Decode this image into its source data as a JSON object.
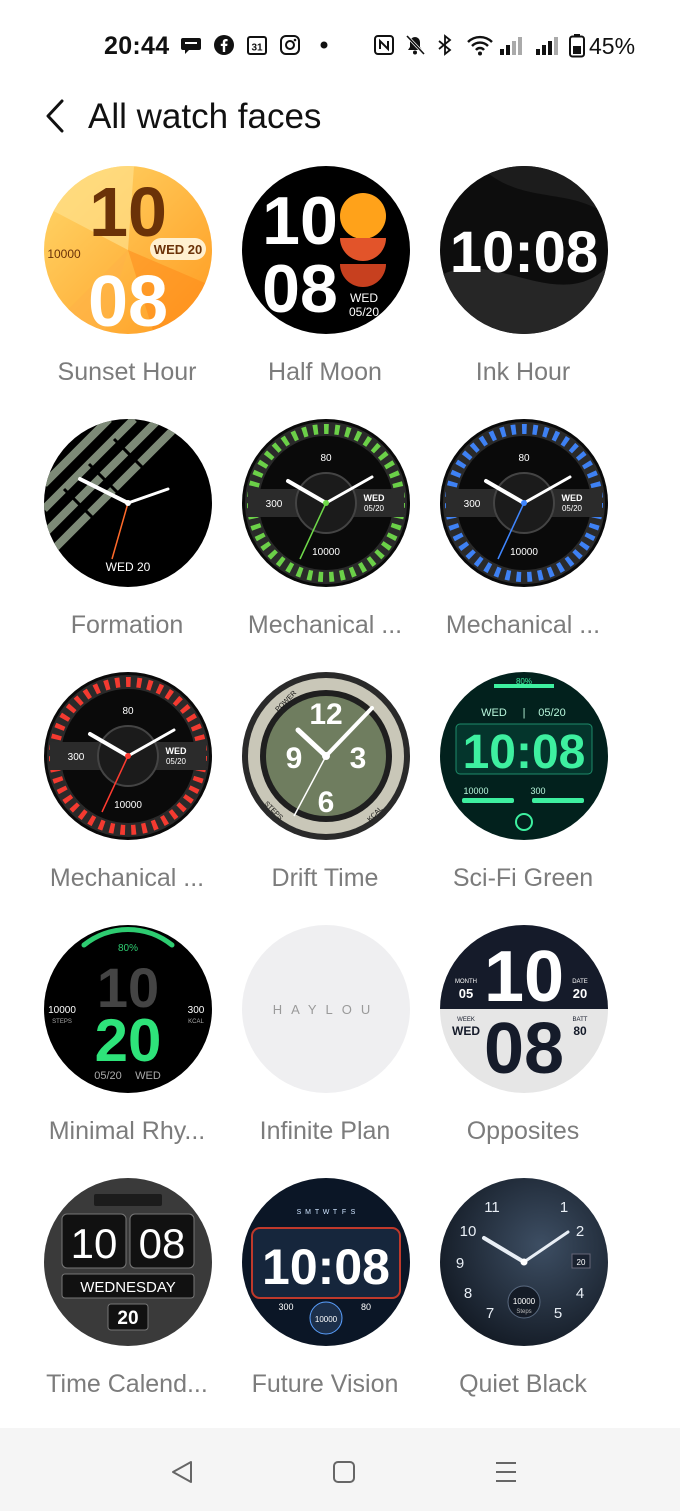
{
  "status_bar": {
    "time": "20:44",
    "battery_percent": "45%",
    "icons": [
      "messages-icon",
      "facebook-icon",
      "calendar-icon",
      "instagram-icon",
      "dot-icon",
      "nfc-icon",
      "mute-icon",
      "bluetooth-icon",
      "wifi-icon",
      "signal-icon",
      "signal-icon",
      "battery-icon"
    ]
  },
  "header": {
    "title": "All watch faces",
    "back_icon": "chevron-left-icon"
  },
  "faces": [
    {
      "label": "Sunset Hour",
      "hour": "10",
      "minute": "08",
      "date": "WED 20",
      "steps": "10000"
    },
    {
      "label": "Half Moon",
      "hour": "10",
      "minute": "08",
      "day": "WED",
      "date": "05/20"
    },
    {
      "label": "Ink Hour",
      "time": "10:08"
    },
    {
      "label": "Formation",
      "date": "WED 20"
    },
    {
      "label": "Mechanical ...",
      "hr": "80",
      "kcal": "300",
      "day": "WED",
      "date": "05/20",
      "steps": "10000",
      "accent": "#6fd94a"
    },
    {
      "label": "Mechanical ...",
      "hr": "80",
      "kcal": "300",
      "day": "WED",
      "date": "05/20",
      "steps": "10000",
      "accent": "#3f86ff"
    },
    {
      "label": "Mechanical ...",
      "hr": "80",
      "kcal": "300",
      "day": "WED",
      "date": "05/20",
      "steps": "10000",
      "accent": "#ff3b30"
    },
    {
      "label": "Drift Time",
      "n12": "12",
      "n9": "9",
      "n3": "3",
      "n6": "6",
      "power": "POWER",
      "steps": "STEPS",
      "kcal": "KCAL"
    },
    {
      "label": "Sci-Fi Green",
      "battery": "80%",
      "day": "WED",
      "date": "05/20",
      "time": "10:08",
      "steps": "10000",
      "kcal": "300"
    },
    {
      "label": "Minimal Rhy...",
      "battery": "80%",
      "hour": "10",
      "minute": "20",
      "steps": "10000",
      "steps_label": "STEPS",
      "kcal": "300",
      "kcal_label": "KCAL",
      "date": "05/20",
      "day": "WED"
    },
    {
      "label": "Infinite Plan",
      "brand": "HAYLOU"
    },
    {
      "label": "Opposites",
      "month_label": "MONTH",
      "month": "05",
      "date_label": "DATE",
      "date": "20",
      "week_label": "WEEK",
      "week": "WED",
      "batt_label": "BATT",
      "batt": "80",
      "hour": "10",
      "minute": "08"
    },
    {
      "label": "Time Calend...",
      "hour": "10",
      "minute": "08",
      "day": "WEDNESDAY",
      "date": "20"
    },
    {
      "label": "Future Vision",
      "week": [
        "S",
        "M",
        "T",
        "W",
        "T",
        "F",
        "S"
      ],
      "time": "10:08",
      "kcal": "300",
      "hr": "80",
      "steps": "10000"
    },
    {
      "label": "Quiet Black",
      "numerals": [
        "11",
        "10",
        "9",
        "8",
        "7",
        "1",
        "2",
        "4",
        "5"
      ],
      "date": "20",
      "steps": "10000",
      "steps_label": "Steps"
    }
  ],
  "nav": {
    "back_icon": "triangle-back-icon",
    "home_icon": "square-home-icon",
    "menu_icon": "menu-icon"
  }
}
